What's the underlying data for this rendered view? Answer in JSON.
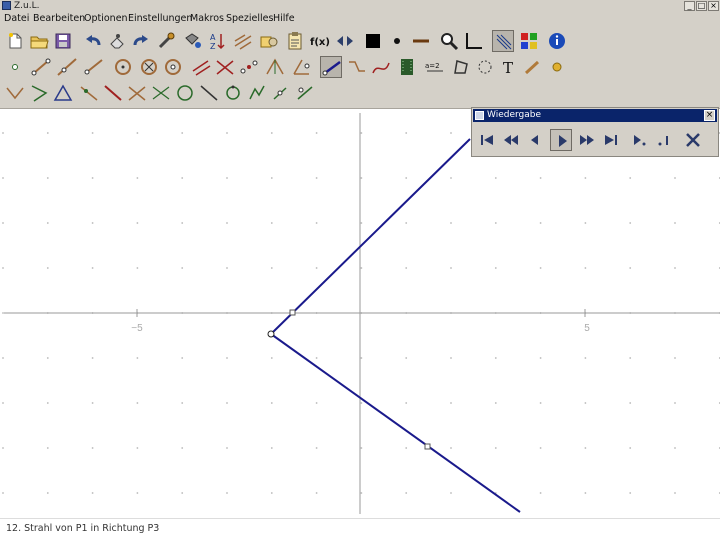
{
  "window": {
    "title": "Z.u.L."
  },
  "menu": [
    {
      "id": "datei",
      "label": "Datei"
    },
    {
      "id": "bearbeiten",
      "label": "Bearbeiten"
    },
    {
      "id": "optionen",
      "label": "Optionen"
    },
    {
      "id": "einstellungen",
      "label": "Einstellungen"
    },
    {
      "id": "makros",
      "label": "Makros"
    },
    {
      "id": "spezielles",
      "label": "Spezielles"
    },
    {
      "id": "hilfe",
      "label": "Hilfe"
    }
  ],
  "toolbar": {
    "function_label": "f(x)",
    "text_label": "T",
    "row1_icons": [
      "new-file-icon",
      "open-file-icon",
      "save-file-icon",
      "undo-icon",
      "delete-icon",
      "redo-icon",
      "edit-tool-icon",
      "color-tool-icon",
      "sort-icon",
      "hide-lines-icon",
      "macro-icon",
      "clipboard-icon",
      "function-icon",
      "arrows-icon",
      "black-square-icon",
      "point-size-icon",
      "line-width-icon",
      "zoom-icon",
      "axes-icon",
      "grid-icon",
      "color-palette-icon",
      "info-icon"
    ],
    "row2_icons": [
      "point-icon",
      "segment-icon",
      "line-icon",
      "ray-icon",
      "circle-icon",
      "circle-fixed-icon",
      "circle-center-icon",
      "parallel-icon",
      "intersection-icon",
      "midpoint-icon",
      "angle-bisector-icon",
      "angle-icon",
      "ray-direction-icon",
      "polygon-line-icon",
      "curve-icon",
      "film-icon",
      "equal-icon",
      "quadrilateral-icon",
      "circle-points-icon",
      "text-icon",
      "hide-icon",
      "animate-icon"
    ],
    "row3_icons": [
      "vector-icon",
      "triangle-icon",
      "triangle-marked-icon",
      "line-through-icon",
      "perpendicular-icon",
      "intersect-lines-icon",
      "circle-three-points-icon",
      "tangent-icon",
      "arc-icon",
      "parallel-lines-icon",
      "reflect-icon",
      "rotate-icon",
      "translate-icon"
    ]
  },
  "playback_window": {
    "title": "Wiedergabe",
    "close_label": "×",
    "buttons": [
      "skip-start-icon",
      "fast-backward-icon",
      "step-backward-icon",
      "play-icon",
      "fast-forward-icon",
      "skip-end-icon",
      "step-forward-icon",
      "step-end-icon",
      "close-playback-icon"
    ],
    "active_button": "play-icon"
  },
  "canvas": {
    "axis_labels": {
      "x_neg": "−5",
      "x_pos": "5"
    }
  },
  "status": {
    "text": "12. Strahl von P1 in Richtung P3"
  },
  "colors": {
    "accent": "#0a246a",
    "construction_line": "#1a1a8c",
    "chrome": "#d4d0c8"
  }
}
